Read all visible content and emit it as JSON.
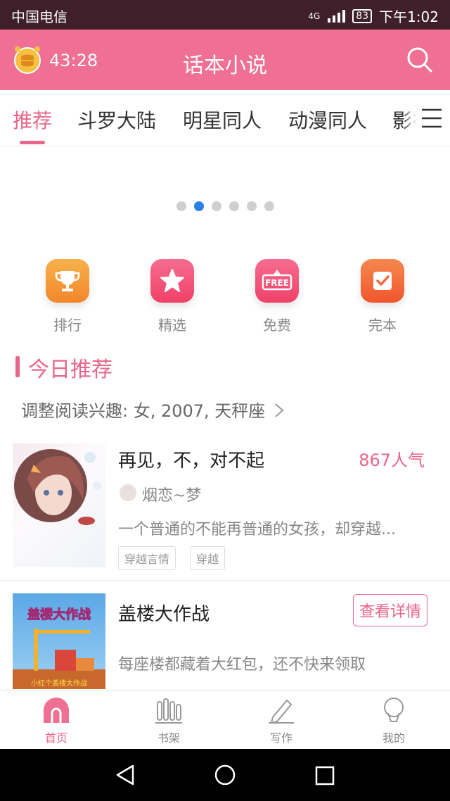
{
  "status_bar": {
    "carrier": "中国电信",
    "network": "4G",
    "battery": "83",
    "time": "下午1:02"
  },
  "header": {
    "timer": "43:28",
    "title": "话本小说",
    "icons": {
      "coin": "coin-clock-icon",
      "search": "search-icon"
    },
    "background": "#ef7093"
  },
  "tabs": [
    {
      "label": "推荐",
      "active": true
    },
    {
      "label": "斗罗大陆"
    },
    {
      "label": "明星同人"
    },
    {
      "label": "动漫同人"
    },
    {
      "label": "影视"
    }
  ],
  "carousel": {
    "count": 6,
    "active_index": 1
  },
  "categories": [
    {
      "label": "排行",
      "icon": "trophy-icon",
      "color": "#f59c2f"
    },
    {
      "label": "精选",
      "icon": "star-icon",
      "color": "#f2567c"
    },
    {
      "label": "免费",
      "icon": "free-tag-icon",
      "color": "#f2567c",
      "icon_text": "FREE"
    },
    {
      "label": "完本",
      "icon": "check-note-icon",
      "color": "#f46a37"
    }
  ],
  "section": {
    "title": "今日推荐",
    "interest": "调整阅读兴趣: 女, 2007, 天秤座"
  },
  "books": [
    {
      "title": "再见，不，对不起",
      "popularity": "867人气",
      "author": "烟恋~梦",
      "description": "一个普通的不能再普通的女孩，却穿越...",
      "tags": [
        "穿越言情",
        "穿越"
      ]
    },
    {
      "title": "盖楼大作战",
      "button": "查看详情",
      "description": "每座楼都藏着大红包，还不快来领取",
      "cover_text": "盖楼大作战",
      "cover_caption": "小红个盖楼大作战"
    }
  ],
  "bottom_nav": [
    {
      "label": "首页",
      "icon": "home-icon",
      "active": true
    },
    {
      "label": "书架",
      "icon": "bookshelf-icon"
    },
    {
      "label": "写作",
      "icon": "pen-icon"
    },
    {
      "label": "我的",
      "icon": "profile-icon"
    }
  ],
  "colors": {
    "accent": "#e9668b",
    "dot_active": "#2b7fe7"
  }
}
